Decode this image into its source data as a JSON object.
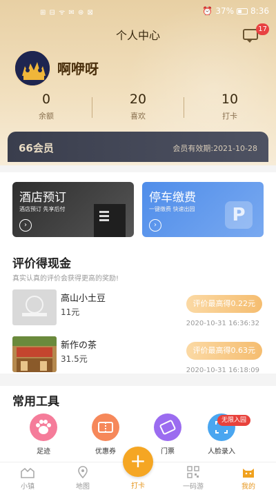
{
  "status_bar": {
    "left": "⊞ ⊟ ᯤ ✉ ⊛ ⊠",
    "battery": "37%",
    "time": "8:36"
  },
  "header": {
    "title": "个人中心",
    "message_badge": "17",
    "username": "啊咿呀"
  },
  "stats": [
    {
      "value": "0",
      "label": "余额"
    },
    {
      "value": "20",
      "label": "喜欢"
    },
    {
      "value": "10",
      "label": "打卡"
    }
  ],
  "member": {
    "name": "66会员",
    "expiry": "会员有效期:2021-10-28"
  },
  "banners": {
    "hotel": {
      "title": "酒店预订",
      "subtitle": "酒店预订 先享后付"
    },
    "parking": {
      "title": "停车缴费",
      "subtitle": "一键缴费   快速出园"
    }
  },
  "reviews": {
    "title": "评价得现金",
    "subtitle": "真实认真的评价会获得更高的奖励!",
    "items": [
      {
        "name": "高山小土豆",
        "price": "11元",
        "reward": "评价最高得0.22元",
        "time": "2020-10-31 16:36:32"
      },
      {
        "name": "新作の茶",
        "price": "31.5元",
        "reward": "评价最高得0.63元",
        "time": "2020-10-31 16:18:09"
      }
    ]
  },
  "tools": {
    "title": "常用工具",
    "items": [
      {
        "label": "足迹",
        "icon": "paw-icon"
      },
      {
        "label": "优惠券",
        "icon": "coupon-icon"
      },
      {
        "label": "门票",
        "icon": "ticket-icon"
      },
      {
        "label": "人脸录入",
        "icon": "face-icon"
      }
    ],
    "tag": "无限入园"
  },
  "tabbar": {
    "items": [
      {
        "label": "小镇",
        "icon": "town-icon"
      },
      {
        "label": "地图",
        "icon": "map-icon"
      },
      {
        "label": "打卡",
        "icon": "plus-icon"
      },
      {
        "label": "一码游",
        "icon": "qrcode-icon"
      },
      {
        "label": "我的",
        "icon": "cat-icon"
      }
    ]
  },
  "colors": {
    "accent": "#f5a623",
    "gold_bg": "#e8d0a4",
    "parking_blue": "#4f8dea",
    "badge_red": "#e84242"
  }
}
